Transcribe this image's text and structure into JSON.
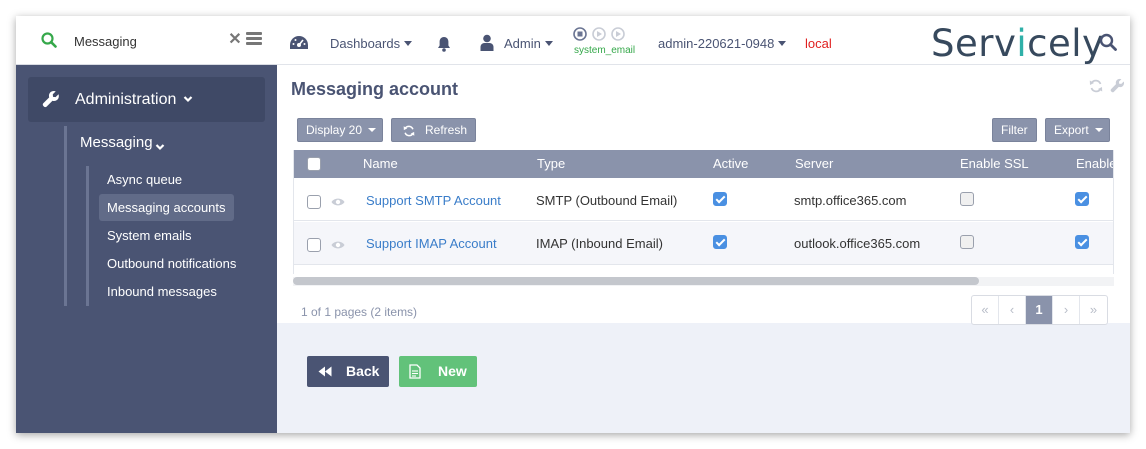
{
  "sidebar": {
    "search": {
      "value": "Messaging"
    },
    "section": {
      "label": "Administration"
    },
    "group": {
      "label": "Messaging"
    },
    "items": [
      {
        "label": "Async queue",
        "active": false
      },
      {
        "label": "Messaging accounts",
        "active": true
      },
      {
        "label": "System emails",
        "active": false
      },
      {
        "label": "Outbound notifications",
        "active": false
      },
      {
        "label": "Inbound messages",
        "active": false
      }
    ]
  },
  "topbar": {
    "dashboards": "Dashboards",
    "admin": "Admin",
    "system_email": "system_email",
    "instance": "admin-220621-0948",
    "env": "local",
    "brand": {
      "pre": "Serv",
      "accent": "i",
      "post": "cely"
    }
  },
  "page": {
    "title": "Messaging account"
  },
  "toolbar": {
    "display": "Display 20",
    "refresh": "Refresh",
    "filter": "Filter",
    "export": "Export"
  },
  "table": {
    "columns": [
      "Name",
      "Type",
      "Active",
      "Server",
      "Enable SSL",
      "Enable"
    ],
    "rows": [
      {
        "name": "Support SMTP Account",
        "type": "SMTP (Outbound Email)",
        "active": true,
        "server": "smtp.office365.com",
        "ssl": false,
        "enable": true
      },
      {
        "name": "Support IMAP Account",
        "type": "IMAP (Inbound Email)",
        "active": true,
        "server": "outlook.office365.com",
        "ssl": false,
        "enable": true
      }
    ]
  },
  "pagination": {
    "info": "1 of 1 pages (2 items)",
    "first": "«",
    "prev": "‹",
    "current": "1",
    "next": "›",
    "last": "»"
  },
  "actions": {
    "back": "Back",
    "new": "New"
  },
  "colors": {
    "sidebar": "#4a5473",
    "header": "#8a93ab",
    "link": "#3a7dc9",
    "new_button": "#62c27a",
    "env": "#e02020",
    "status_green": "#35a84a"
  },
  "icons": [
    "search-icon",
    "close-icon",
    "menu-icon",
    "wrench-icon",
    "chevron-down-icon",
    "dashboard-icon",
    "bell-icon",
    "user-icon",
    "stop-icon",
    "play-icon",
    "refresh-icon",
    "eye-icon",
    "backward-icon",
    "document-icon"
  ]
}
